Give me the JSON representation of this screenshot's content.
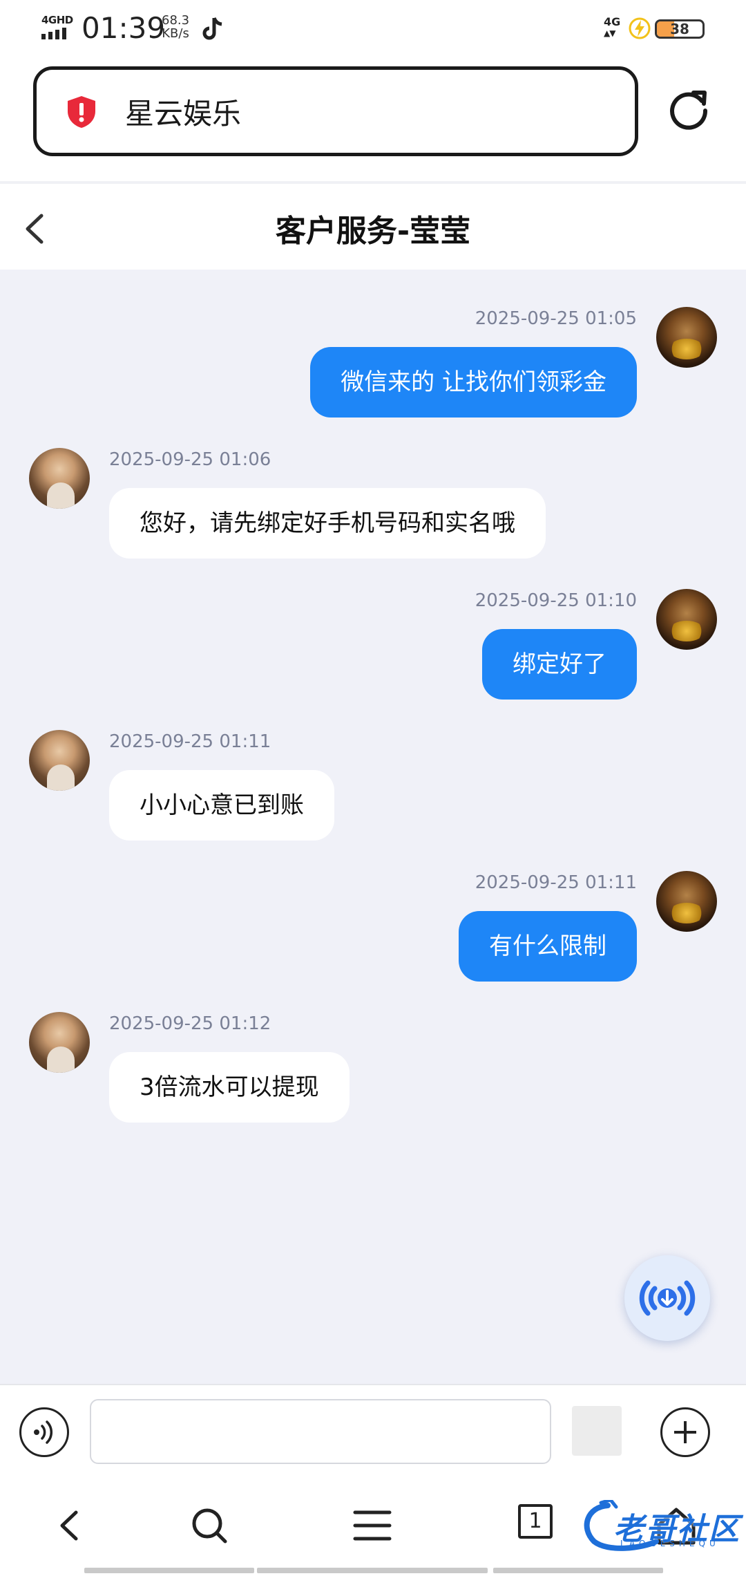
{
  "status_bar": {
    "network": "4GHD",
    "time": "01:39",
    "speed_value": "68.3",
    "speed_unit": "KB/s",
    "right_network": "4G",
    "battery": "38",
    "battery_level": 0.38
  },
  "browser": {
    "url_text": "星云娱乐",
    "tab_count": "1"
  },
  "chat": {
    "title": "客户服务-莹莹",
    "messages": [
      {
        "side": "out",
        "time": "2025-09-25 01:05",
        "text": "微信来的 让找你们领彩金"
      },
      {
        "side": "in",
        "time": "2025-09-25 01:06",
        "text": "您好，请先绑定好手机号码和实名哦"
      },
      {
        "side": "out",
        "time": "2025-09-25 01:10",
        "text": "绑定好了"
      },
      {
        "side": "in",
        "time": "2025-09-25 01:11",
        "text": "小小心意已到账"
      },
      {
        "side": "out",
        "time": "2025-09-25 01:11",
        "text": "有什么限制"
      },
      {
        "side": "in",
        "time": "2025-09-25 01:12",
        "text": "3倍流水可以提现"
      }
    ]
  },
  "input": {
    "value": "",
    "placeholder": ""
  },
  "watermark": {
    "text": "老哥社区",
    "sub": "LAOGESHEQU"
  },
  "colors": {
    "outgoing_bubble": "#1e86f7",
    "chat_background": "#f0f1f8",
    "security_red": "#e8293a"
  },
  "icons": [
    "shield-alert-icon",
    "reload-icon",
    "back-icon",
    "download-speaker-icon",
    "voice-icon",
    "plus-icon",
    "nav-back-icon",
    "search-icon",
    "menu-icon",
    "home-icon"
  ]
}
